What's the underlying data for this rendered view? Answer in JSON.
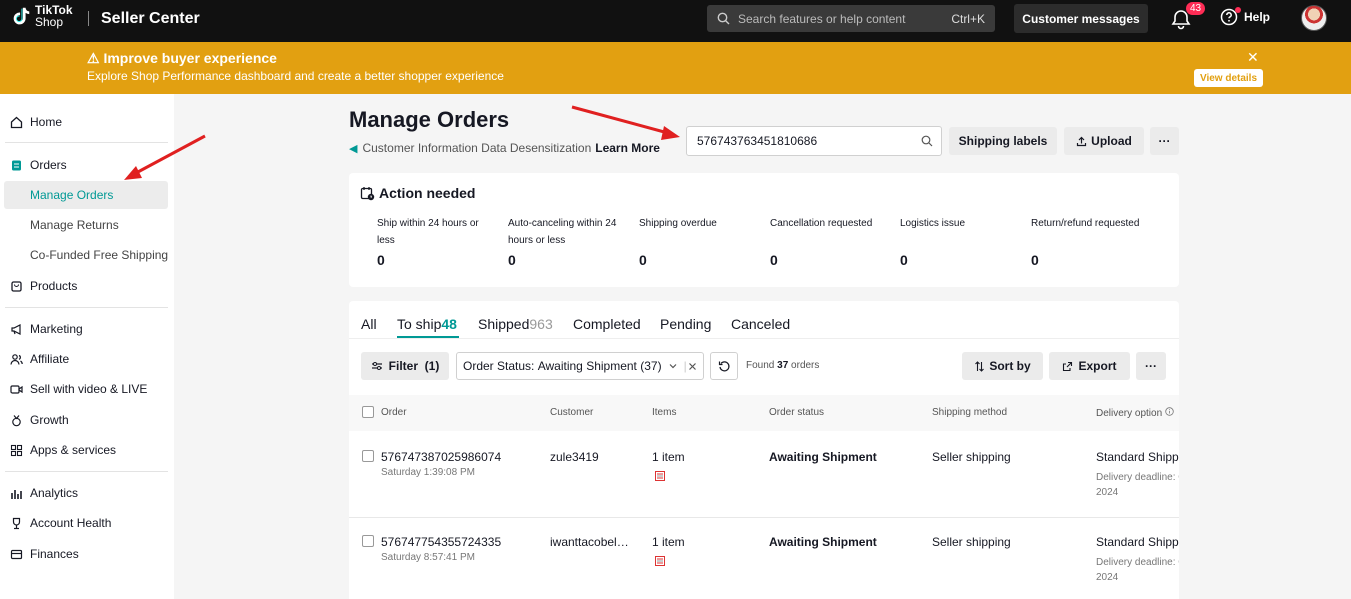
{
  "app": {
    "logo_line1": "TikTok",
    "logo_line2": "Shop",
    "name": "Seller Center"
  },
  "topbar": {
    "search_placeholder": "Search features or help content",
    "search_shortcut": "Ctrl+K",
    "customer_messages": "Customer messages",
    "notification_count": "43",
    "help": "Help"
  },
  "banner": {
    "title": "⚠ Improve buyer experience",
    "subtitle": "Explore Shop Performance dashboard and create a better shopper experience",
    "close": "✕",
    "view_details": "View details"
  },
  "sidebar": {
    "home": "Home",
    "orders": "Orders",
    "manage_orders": "Manage Orders",
    "manage_returns": "Manage Returns",
    "cofunded": "Co-Funded Free Shipping",
    "products": "Products",
    "marketing": "Marketing",
    "affiliate": "Affiliate",
    "sell_video": "Sell with video & LIVE",
    "growth": "Growth",
    "apps": "Apps & services",
    "analytics": "Analytics",
    "account_health": "Account Health",
    "finances": "Finances"
  },
  "header": {
    "title": "Manage Orders",
    "info_text": "Customer Information Data Desensitization",
    "learn_more": "Learn More",
    "search_value": "576743763451810686",
    "shipping_labels": "Shipping labels",
    "upload": "Upload",
    "more": "···"
  },
  "action_needed": {
    "title": "Action needed",
    "items": [
      {
        "label": "Ship within 24 hours or less",
        "value": "0"
      },
      {
        "label": "Auto-canceling within 24 hours or less",
        "value": "0"
      },
      {
        "label": "Shipping overdue",
        "value": "0"
      },
      {
        "label": "Cancellation requested",
        "value": "0"
      },
      {
        "label": "Logistics issue",
        "value": "0"
      },
      {
        "label": "Return/refund requested",
        "value": "0"
      }
    ]
  },
  "tabs": [
    {
      "label": "All",
      "count": ""
    },
    {
      "label": "To ship",
      "count": "48"
    },
    {
      "label": "Shipped",
      "count": "963"
    },
    {
      "label": "Completed",
      "count": ""
    },
    {
      "label": "Pending",
      "count": ""
    },
    {
      "label": "Canceled",
      "count": ""
    }
  ],
  "filters": {
    "filter_label": "Filter",
    "filter_count": "(1)",
    "status_label": "Order Status:",
    "status_value": "Awaiting Shipment (37)",
    "found_prefix": "Found",
    "found_count": "37",
    "found_suffix": "orders",
    "sort_by": "Sort by",
    "export": "Export",
    "more": "···"
  },
  "table": {
    "columns": [
      "Order",
      "Customer",
      "Items",
      "Order status",
      "Shipping method",
      "Delivery option"
    ],
    "rows": [
      {
        "order_id": "576747387025986074",
        "order_time": "Saturday 1:39:08 PM",
        "customer": "zule3419",
        "items": "1 item",
        "status": "Awaiting Shipment",
        "shipping_method": "Seller shipping",
        "delivery_option": "Standard Shipping",
        "delivery_deadline": "Delivery deadline: G",
        "delivery_year": "2024"
      },
      {
        "order_id": "576747754355724335",
        "order_time": "Saturday 8:57:41 PM",
        "customer": "iwanttacobel…",
        "items": "1 item",
        "status": "Awaiting Shipment",
        "shipping_method": "Seller shipping",
        "delivery_option": "Standard Shipping",
        "delivery_deadline": "Delivery deadline: G",
        "delivery_year": "2024"
      }
    ]
  },
  "colors": {
    "accent": "#009995",
    "banner": "#e2a011",
    "topbar": "#111111",
    "arrow": "#e02020"
  }
}
